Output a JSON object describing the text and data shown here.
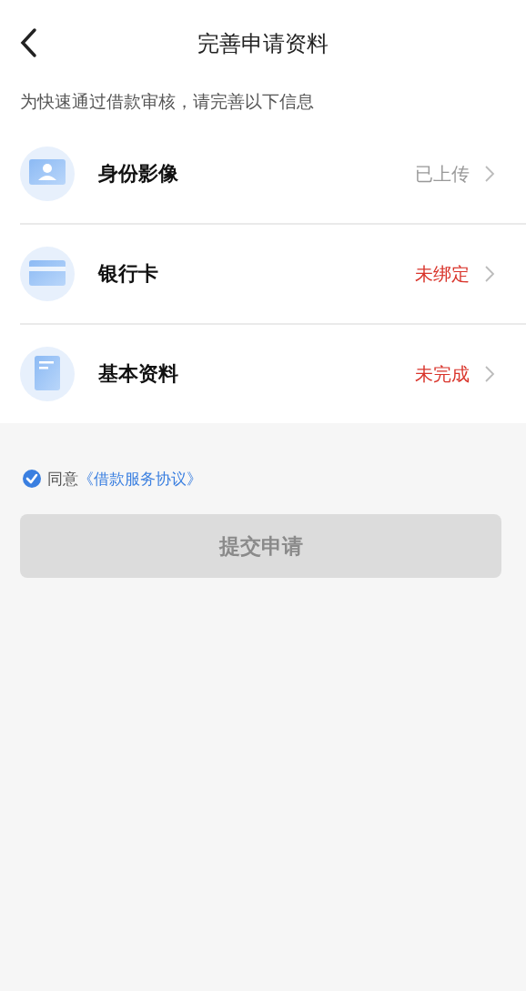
{
  "header": {
    "title": "完善申请资料"
  },
  "subtitle": "为快速通过借款审核，请完善以下信息",
  "items": [
    {
      "kind": "id",
      "label": "身份影像",
      "status": "已上传",
      "done": true
    },
    {
      "kind": "card",
      "label": "银行卡",
      "status": "未绑定",
      "done": false
    },
    {
      "kind": "form",
      "label": "基本资料",
      "status": "未完成",
      "done": false
    }
  ],
  "agreement": {
    "checked": true,
    "prefix": "同意",
    "link": "《借款服务协议》"
  },
  "submit": {
    "label": "提交申请",
    "disabled": true
  }
}
